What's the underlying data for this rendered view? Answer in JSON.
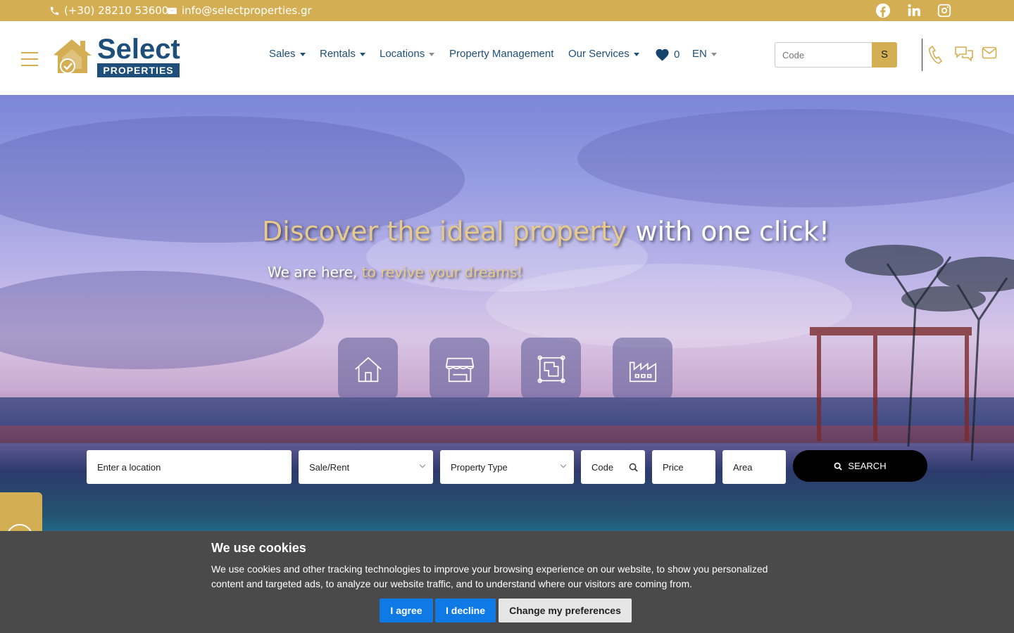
{
  "topbar": {
    "phone": "(+30) 28210 53600",
    "email": "info@selectproperties.gr",
    "social": [
      "facebook-icon",
      "linkedin-icon",
      "instagram-icon"
    ]
  },
  "logo": {
    "word1": "Select",
    "word2": "PROPERTIES"
  },
  "nav": {
    "sales": "Sales",
    "rentals": "Rentals",
    "locations": "Locations",
    "property_management": "Property Management",
    "our_services": "Our Services",
    "favorites_count": "0",
    "language": "EN"
  },
  "code_search": {
    "placeholder": "Code",
    "button": "S"
  },
  "hero": {
    "title_part1": "Discover the ideal property ",
    "title_part2": "with one click!",
    "subtitle_part1": "We are here, ",
    "subtitle_part2": "to revive your dreams!"
  },
  "property_types": [
    "house-icon",
    "store-icon",
    "plot-icon",
    "factory-icon"
  ],
  "search": {
    "location_placeholder": "Enter a location",
    "sale_rent": "Sale/Rent",
    "property_type": "Property Type",
    "code": "Code",
    "price": "Price",
    "area": "Area",
    "button": "SEARCH"
  },
  "cookie": {
    "title": "We use cookies",
    "text": "We use cookies and other tracking technologies to improve your browsing experience on our website, to show you personalized content and targeted ads, to analyze our website traffic, and to understand where our visitors are coming from.",
    "agree": "I agree",
    "decline": "I decline",
    "preferences": "Change my preferences"
  },
  "colors": {
    "gold": "#d4ae52",
    "navy": "#1d4f7a",
    "cookie_blue": "#0f7ae5"
  }
}
